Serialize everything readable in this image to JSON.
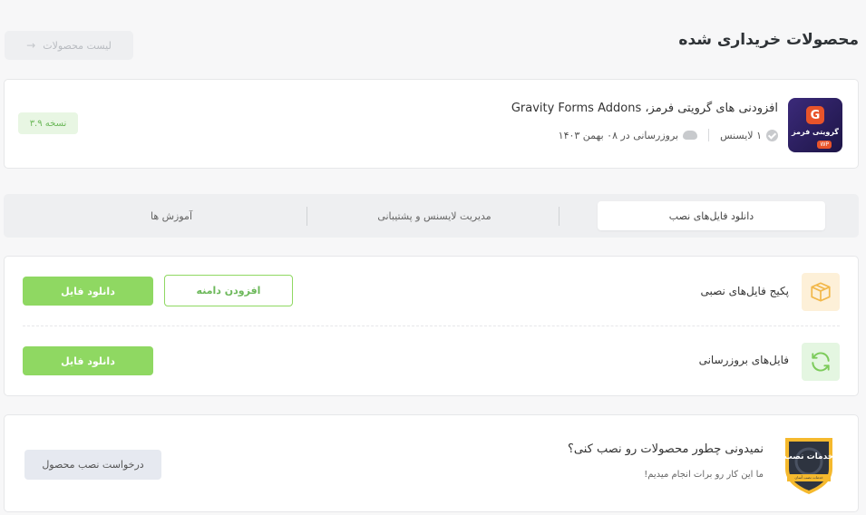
{
  "header": {
    "title": "محصولات خریداری شده",
    "back_label": "لیست محصولات",
    "back_icon": "arrow-right-icon"
  },
  "product": {
    "name": "افزودنی های گرویتی فرمز، Gravity Forms Addons",
    "license": "۱ لایسنس",
    "updated": "بروزرسانی در ۰۸ بهمن ۱۴۰۳",
    "version": "نسخه ۳.۹",
    "logo_text": "گرویتی فرمز",
    "logo_badge": "WP"
  },
  "tabs": [
    {
      "label": "دانلود فایل‌های نصب",
      "active": true
    },
    {
      "label": "مدیریت لایسنس و پشتیبانی",
      "active": false
    },
    {
      "label": "آموزش ها",
      "active": false
    }
  ],
  "files": {
    "package_label": "پکیج فایل‌های نصبی",
    "updates_label": "فایل‌های بروزرسانی",
    "download_label": "دانلود فایل",
    "add_domain_label": "افزودن دامنه"
  },
  "install": {
    "title": "نمیدونی چطور محصولات رو نصب کنی؟",
    "subtitle": "ما این کار رو برات انجام میدیم!",
    "button_label": "درخواست نصب محصول",
    "badge_text": "خدمات نصب",
    "badge_small": "خدمات نصب آسان"
  },
  "colors": {
    "accent_green": "#8fd862",
    "version_green": "#6cb85a",
    "package_bg": "#fdf0d8",
    "update_bg": "#e4f6e1"
  }
}
